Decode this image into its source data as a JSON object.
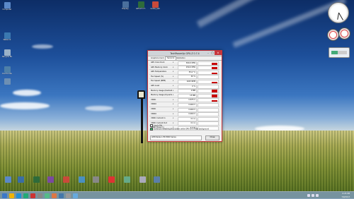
{
  "window": {
    "title": "TechPowerUp GPU-Z 0.7.4",
    "tabs": [
      "Graphics Card",
      "Sensors",
      "Validation"
    ],
    "active_tab": "Sensors",
    "sensors": [
      {
        "name": "GPU Core Clock",
        "value": "300.0 MHz",
        "level": 0.7
      },
      {
        "name": "GPU Memory Clock",
        "value": "150.0 MHz",
        "level": 0.7
      },
      {
        "name": "GPU Temperature",
        "value": "35.0 °C",
        "level": 0.5
      },
      {
        "name": "Fan Speed (%)",
        "value": "30 %",
        "level": 0.0
      },
      {
        "name": "Fan Speed (RPM)",
        "value": "1043 RPM",
        "level": 0.4
      },
      {
        "name": "GPU Load",
        "value": "0 %",
        "level": 0.0
      },
      {
        "name": "Memory Usage (Dedicated)",
        "value": "0 MB",
        "level": 1.0
      },
      {
        "name": "Memory Usage (Dynamic)",
        "value": "15 MB",
        "level": 0.9
      },
      {
        "name": "VDDC",
        "value": "0.875 V",
        "level": 0.6
      },
      {
        "name": "VDDCI",
        "value": "0.900 V",
        "level": 0.0
      },
      {
        "name": "VDDC",
        "value": "0.900 V",
        "level": 0.0
      },
      {
        "name": "VDDCI",
        "value": "0.900 V",
        "level": 0.0
      },
      {
        "name": "VDDC Current In",
        "value": "0.1 A",
        "level": 0.0
      },
      {
        "name": "VDDC Current Out",
        "value": "0.1 A",
        "level": 0.0
      },
      {
        "name": "VDDC Power In",
        "value": "2.5 W",
        "level": 0.0
      }
    ],
    "log_to_file": "Log to file",
    "continue_refresh": "Continue refreshing this screen while GPU-Z is in the background",
    "gpu_select": "AMD Radeon HD 8000 Series",
    "close_label": "Close"
  },
  "desktop_icons": [
    {
      "label": "Computer",
      "color": "#5a88c8"
    },
    {
      "label": "Network",
      "color": "#3a78b0"
    },
    {
      "label": "Recycle Bin",
      "color": "#9bb2c8"
    },
    {
      "label": "Control Panel",
      "color": "#4e7fa8"
    },
    {
      "label": "",
      "color": "#6d8fb3"
    },
    {
      "label": "Display",
      "color": "#4a6f9c"
    },
    {
      "label": "GPU-Z 0.7.4",
      "color": "#2e6b3a"
    },
    {
      "label": "nvidia_setup.exe",
      "color": "#c94a3a"
    }
  ],
  "taskbar_icons": [
    "#3b78c8",
    "#f0b400",
    "#1e90d6",
    "#2a7",
    "#c33",
    "#888",
    "#5b8",
    "#d74",
    "#47a",
    "#999",
    "#6ad"
  ],
  "tray": {
    "time": "6:25 PM",
    "date": "7/9/2013"
  }
}
